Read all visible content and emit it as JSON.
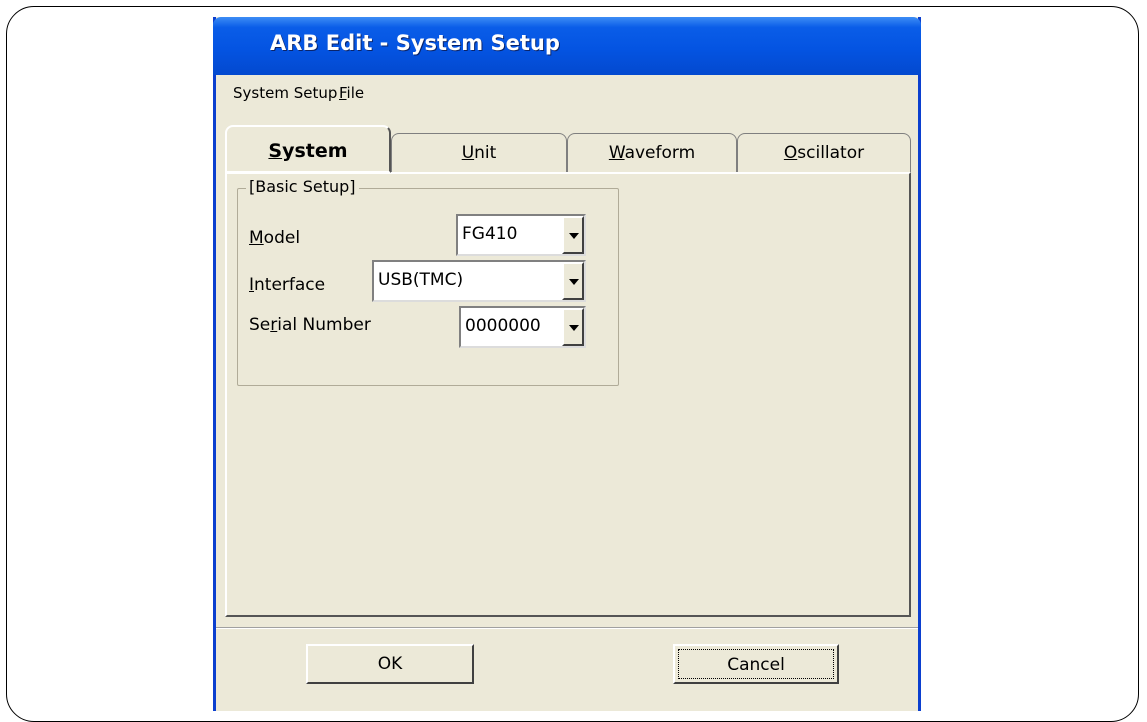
{
  "window": {
    "title": "ARB Edit - System Setup"
  },
  "menu": {
    "items": [
      {
        "label": "System Setup"
      },
      {
        "label_prefix": "",
        "mnemonic": "F",
        "label_rest": "ile"
      }
    ]
  },
  "tabs": [
    {
      "mnemonic": "S",
      "rest": "ystem",
      "active": true
    },
    {
      "mnemonic": "U",
      "rest": "nit",
      "active": false
    },
    {
      "mnemonic": "W",
      "rest": "aveform",
      "active": false
    },
    {
      "mnemonic": "O",
      "rest": "scillator",
      "active": false
    }
  ],
  "basic_setup": {
    "legend": "[Basic Setup]",
    "model": {
      "label_mnemonic": "M",
      "label_rest": "odel",
      "value": "FG410"
    },
    "interface": {
      "label_mnemonic": "I",
      "label_rest": "nterface",
      "value": "USB(TMC)"
    },
    "serial": {
      "label_prefix": "Se",
      "label_mnemonic": "r",
      "label_rest": "ial Number",
      "value": "0000000"
    }
  },
  "buttons": {
    "ok": "OK",
    "cancel": "Cancel"
  },
  "colors": {
    "titlebar": "#0454e2",
    "window_bg": "#ece9d8",
    "border": "#0b3fcf"
  }
}
